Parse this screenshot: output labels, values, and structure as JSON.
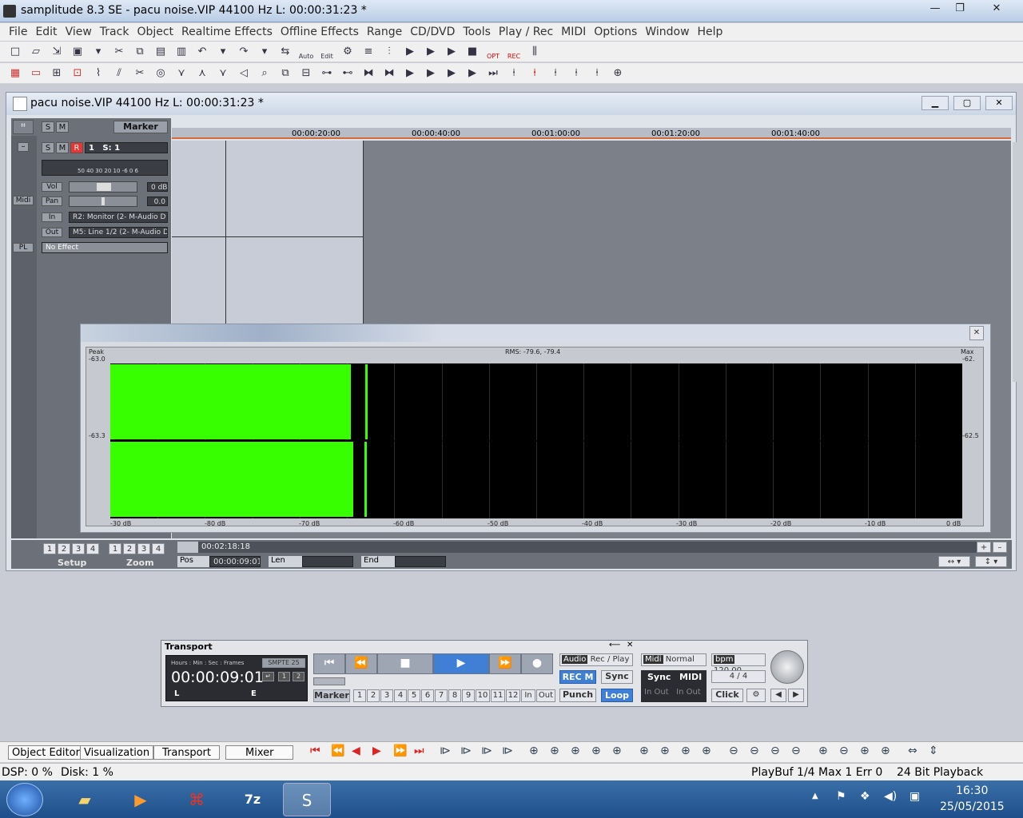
{
  "app": {
    "title": "samplitude 8.3 SE  - pacu noise.VIP   44100 Hz L: 00:00:31:23 *",
    "window_controls": {
      "min": "—",
      "max": "❐",
      "close": "✕"
    }
  },
  "menu": [
    "File",
    "Edit",
    "View",
    "Track",
    "Object",
    "Realtime Effects",
    "Offline Effects",
    "Range",
    "CD/DVD",
    "Tools",
    "Play / Rec",
    "MIDI",
    "Options",
    "Window",
    "Help"
  ],
  "toolbar1": {
    "auto_label": "Auto",
    "edit_label": "Edit",
    "opt_label": "OPT",
    "rec_label": "REC"
  },
  "doc": {
    "title": "pacu noise.VIP   44100 Hz L: 00:00:31:23 *"
  },
  "trackpanel": {
    "s": "S",
    "m": "M",
    "marker": "Marker",
    "r": "R",
    "track_num": "1",
    "s_num": "S: 1",
    "scale": "50 40 30 20  10 -6  0  6",
    "vol": "Vol",
    "vol_val": "0 dB",
    "pan": "Pan",
    "pan_val": "0.0",
    "midi": "Midi",
    "in": "In",
    "in_val": "R2: Monitor (2- M-Audio D",
    "out": "Out",
    "out_val": "M5: Line 1/2 (2- M-Audio Dc",
    "pl": "PL",
    "fx": "No Effect"
  },
  "ruler": [
    "00:00:20:00",
    "00:00:40:00",
    "00:01:00:00",
    "00:01:20:00",
    "00:01:40:00"
  ],
  "meter": {
    "peak_label": "Peak",
    "rms": "RMS: -79.6, -79.4",
    "max_label": "Max",
    "left_top": "-63.0",
    "left_mid": "-63.3",
    "right_top": "-62.",
    "right_mid": "-62.5",
    "scale": [
      "-30 dB",
      "-80 dB",
      "-70 dB",
      "-60 dB",
      "-50 dB",
      "-40 dB",
      "-30 dB",
      "-20 dB",
      "-10 dB",
      "0 dB"
    ],
    "level_top": 0.282,
    "level_bottom": 0.285
  },
  "bottom": {
    "setup": "Setup",
    "zoom": "Zoom",
    "nums": [
      "1",
      "2",
      "3",
      "4"
    ],
    "time": "00:02:18:18",
    "pos": "Pos",
    "pos_val": "00:00:09:01",
    "len": "Len",
    "end": "End"
  },
  "transport": {
    "title": "Transport",
    "fmt": "Hours : Min : Sec : Frames",
    "smpte": "SMPTE 25",
    "time": "00:00:09:01",
    "l": "L",
    "e": "E",
    "marker": "Marker",
    "markers": [
      "1",
      "2",
      "3",
      "4",
      "5",
      "6",
      "7",
      "8",
      "9",
      "10",
      "11",
      "12",
      "In",
      "Out"
    ],
    "audio": "Audio",
    "recplay": "Rec / Play",
    "recm": "REC M",
    "sync": "Sync",
    "punch": "Punch",
    "loop": "Loop",
    "midi": "Midi",
    "normal": "Normal",
    "sync2": "Sync",
    "midi2": "MIDI",
    "inout": "In Out   In Out",
    "bpm": "bpm",
    "bpm_val": "120.00",
    "sig": "4 / 4",
    "click": "Click"
  },
  "tabs": [
    "Object Editor",
    "Visualization",
    "Transport",
    "Mixer"
  ],
  "status": {
    "dsp": "DSP: 0 %",
    "disk": "Disk: 1 %",
    "playbuf": "PlayBuf 1/4  Max 1  Err 0",
    "bits": "24 Bit Playback"
  },
  "tray": {
    "time": "16:30",
    "date": "25/05/2015"
  },
  "colors": {
    "meter_green": "#38ff00",
    "accent_blue": "#3f7fd6"
  }
}
